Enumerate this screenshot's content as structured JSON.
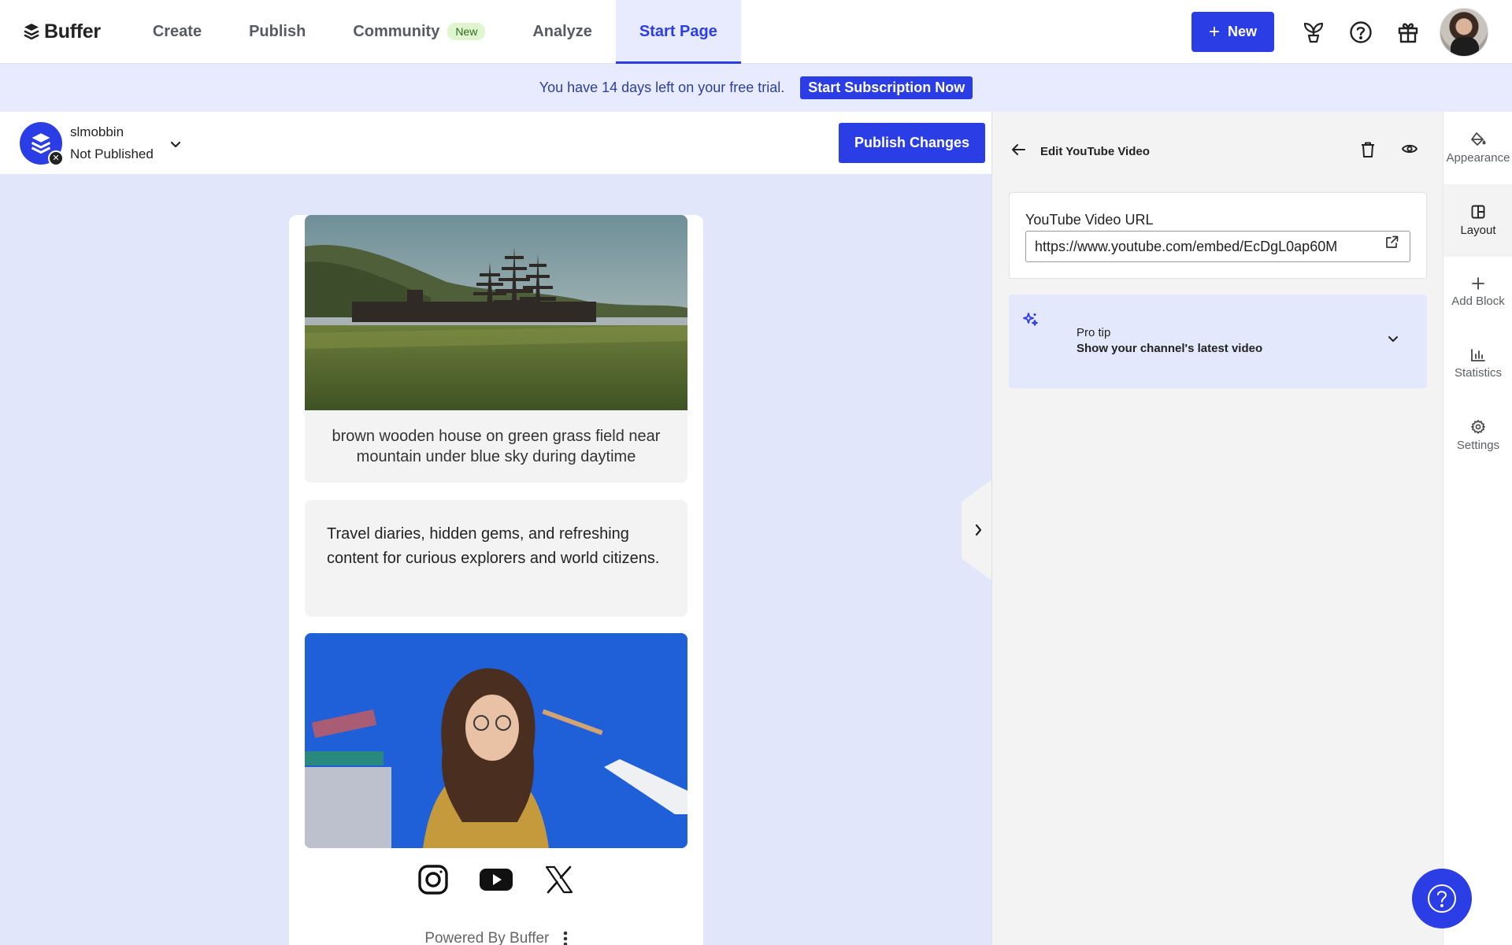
{
  "brand": {
    "name": "Buffer"
  },
  "nav": {
    "items": [
      {
        "label": "Create"
      },
      {
        "label": "Publish"
      },
      {
        "label": "Community",
        "badge": "New"
      },
      {
        "label": "Analyze"
      },
      {
        "label": "Start Page",
        "active": true
      }
    ],
    "new_button": "New",
    "icons": [
      "sprout-icon",
      "help-icon",
      "gift-icon",
      "avatar"
    ]
  },
  "trial": {
    "message": "You have 14 days left on your free trial.",
    "cta": "Start Subscription Now"
  },
  "page": {
    "name": "slmobbin",
    "status": "Not Published",
    "publish_button": "Publish Changes"
  },
  "preview": {
    "image_caption": "brown wooden house on green grass field near mountain under blue sky during daytime",
    "text_block": "Travel diaries, hidden gems, and refreshing content for curious explorers and world citizens.",
    "socials": [
      "instagram-icon",
      "youtube-icon",
      "x-icon"
    ],
    "footer": "Powered By Buffer"
  },
  "editor": {
    "title": "Edit YouTube Video",
    "url_label": "YouTube Video URL",
    "url_value": "https://www.youtube.com/embed/EcDgL0ap60M",
    "tip_label": "Pro tip",
    "tip_text": "Show your channel's latest video"
  },
  "rail": {
    "items": [
      {
        "label": "Appearance",
        "icon": "paint-bucket-icon"
      },
      {
        "label": "Layout",
        "icon": "layout-icon",
        "active": true
      },
      {
        "label": "Add Block",
        "icon": "plus-icon"
      },
      {
        "label": "Statistics",
        "icon": "bar-chart-icon"
      },
      {
        "label": "Settings",
        "icon": "gear-icon"
      }
    ]
  },
  "colors": {
    "primary": "#2b3ee6",
    "banner_bg": "#e7ebfd",
    "canvas_bg": "#e2e6fb",
    "badge_bg": "#dff5d0"
  }
}
